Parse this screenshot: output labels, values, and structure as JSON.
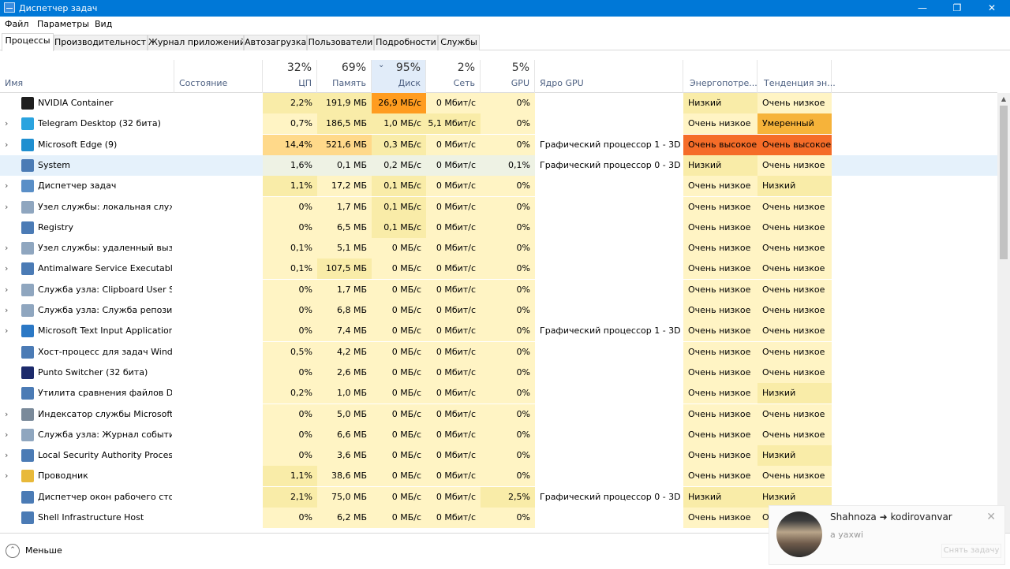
{
  "window": {
    "title": "Диспетчер задач",
    "minimize": "—",
    "maximize": "❐",
    "close": "✕"
  },
  "menu": [
    "Файл",
    "Параметры",
    "Вид"
  ],
  "tabs": [
    "Процессы",
    "Производительность",
    "Журнал приложений",
    "Автозагрузка",
    "Пользователи",
    "Подробности",
    "Службы"
  ],
  "columns": {
    "name": "Имя",
    "status": "Состояние",
    "cpu": {
      "pct": "32%",
      "label": "ЦП"
    },
    "mem": {
      "pct": "69%",
      "label": "Память"
    },
    "disk": {
      "pct": "95%",
      "label": "Диск",
      "sort": "⌄"
    },
    "net": {
      "pct": "2%",
      "label": "Сеть"
    },
    "gpu": {
      "pct": "5%",
      "label": "GPU"
    },
    "gpu_engine": "Ядро GPU",
    "power": "Энергопотре...",
    "power_trend": "Тенденция эн..."
  },
  "colors": {
    "heat_light": "#fff4c4",
    "heat_low": "#f9eca8",
    "heat_mid": "#ffd98a",
    "heat_high": "#f6b33a",
    "heat_orange": "#ff9c1f",
    "heat_red": "#f56c28"
  },
  "processes": [
    {
      "expand": "",
      "icon": "nvidia-icon",
      "icon_color": "#1e1e1e",
      "name": "NVIDIA Container",
      "status": "",
      "cpu": "2,2%",
      "mem": "191,9 МБ",
      "disk": "26,9 МБ/с",
      "net": "0 Мбит/с",
      "gpu": "0%",
      "engine": "",
      "power": "Низкий",
      "trend": "Очень низкое"
    },
    {
      "expand": "›",
      "icon": "telegram-icon",
      "icon_color": "#2aa3df",
      "name": "Telegram Desktop (32 бита)",
      "status": "",
      "cpu": "0,7%",
      "mem": "186,5 МБ",
      "disk": "1,0 МБ/с",
      "net": "5,1 Мбит/с",
      "gpu": "0%",
      "engine": "",
      "power": "Очень низкое",
      "trend": "Умеренный"
    },
    {
      "expand": "›",
      "icon": "edge-icon",
      "icon_color": "#1f8fd0",
      "name": "Microsoft Edge (9)",
      "status": "",
      "cpu": "14,4%",
      "mem": "521,6 МБ",
      "disk": "0,3 МБ/с",
      "net": "0 Мбит/с",
      "gpu": "0%",
      "engine": "Графический процессор 1 - 3D",
      "power": "Очень высокое",
      "trend": "Очень высокое"
    },
    {
      "expand": "",
      "icon": "system-icon",
      "icon_color": "#4b7bb5",
      "name": "System",
      "status": "",
      "cpu": "1,6%",
      "mem": "0,1 МБ",
      "disk": "0,2 МБ/с",
      "net": "0 Мбит/с",
      "gpu": "0,1%",
      "engine": "Графический процессор 0 - 3D",
      "power": "Низкий",
      "trend": "Очень низкое"
    },
    {
      "expand": "›",
      "icon": "task-manager-icon",
      "icon_color": "#5a8fc7",
      "name": "Диспетчер задач",
      "status": "",
      "cpu": "1,1%",
      "mem": "17,2 МБ",
      "disk": "0,1 МБ/с",
      "net": "0 Мбит/с",
      "gpu": "0%",
      "engine": "",
      "power": "Очень низкое",
      "trend": "Низкий"
    },
    {
      "expand": "›",
      "icon": "gear-icon",
      "icon_color": "#8fa6bf",
      "name": "Узел службы: локальная служ...",
      "status": "",
      "cpu": "0%",
      "mem": "1,7 МБ",
      "disk": "0,1 МБ/с",
      "net": "0 Мбит/с",
      "gpu": "0%",
      "engine": "",
      "power": "Очень низкое",
      "trend": "Очень низкое"
    },
    {
      "expand": "",
      "icon": "window-icon",
      "icon_color": "#4b7bb5",
      "name": "Registry",
      "status": "",
      "cpu": "0%",
      "mem": "6,5 МБ",
      "disk": "0,1 МБ/с",
      "net": "0 Мбит/с",
      "gpu": "0%",
      "engine": "",
      "power": "Очень низкое",
      "trend": "Очень низкое"
    },
    {
      "expand": "›",
      "icon": "gear-icon",
      "icon_color": "#8fa6bf",
      "name": "Узел службы: удаленный вызо...",
      "status": "",
      "cpu": "0,1%",
      "mem": "5,1 МБ",
      "disk": "0 МБ/с",
      "net": "0 Мбит/с",
      "gpu": "0%",
      "engine": "",
      "power": "Очень низкое",
      "trend": "Очень низкое"
    },
    {
      "expand": "›",
      "icon": "window-icon",
      "icon_color": "#4b7bb5",
      "name": "Antimalware Service Executable",
      "status": "",
      "cpu": "0,1%",
      "mem": "107,5 МБ",
      "disk": "0 МБ/с",
      "net": "0 Мбит/с",
      "gpu": "0%",
      "engine": "",
      "power": "Очень низкое",
      "trend": "Очень низкое"
    },
    {
      "expand": "›",
      "icon": "gear-icon",
      "icon_color": "#8fa6bf",
      "name": "Служба узла: Clipboard User Se...",
      "status": "",
      "cpu": "0%",
      "mem": "1,7 МБ",
      "disk": "0 МБ/с",
      "net": "0 Мбит/с",
      "gpu": "0%",
      "engine": "",
      "power": "Очень низкое",
      "trend": "Очень низкое"
    },
    {
      "expand": "›",
      "icon": "gear-icon",
      "icon_color": "#8fa6bf",
      "name": "Служба узла: Служба репозит...",
      "status": "",
      "cpu": "0%",
      "mem": "6,8 МБ",
      "disk": "0 МБ/с",
      "net": "0 Мбит/с",
      "gpu": "0%",
      "engine": "",
      "power": "Очень низкое",
      "trend": "Очень низкое"
    },
    {
      "expand": "›",
      "icon": "text-input-icon",
      "icon_color": "#2b78c5",
      "name": "Microsoft Text Input Application",
      "status": "",
      "cpu": "0%",
      "mem": "7,4 МБ",
      "disk": "0 МБ/с",
      "net": "0 Мбит/с",
      "gpu": "0%",
      "engine": "Графический процессор 1 - 3D",
      "power": "Очень низкое",
      "trend": "Очень низкое"
    },
    {
      "expand": "",
      "icon": "window-icon",
      "icon_color": "#4b7bb5",
      "name": "Хост-процесс для задач Windo...",
      "status": "",
      "cpu": "0,5%",
      "mem": "4,2 МБ",
      "disk": "0 МБ/с",
      "net": "0 Мбит/с",
      "gpu": "0%",
      "engine": "",
      "power": "Очень низкое",
      "trend": "Очень низкое"
    },
    {
      "expand": "",
      "icon": "punto-icon",
      "icon_color": "#1c2a6b",
      "name": "Punto Switcher (32 бита)",
      "status": "",
      "cpu": "0%",
      "mem": "2,6 МБ",
      "disk": "0 МБ/с",
      "net": "0 Мбит/с",
      "gpu": "0%",
      "engine": "",
      "power": "Очень низкое",
      "trend": "Очень низкое"
    },
    {
      "expand": "",
      "icon": "window-icon",
      "icon_color": "#4b7bb5",
      "name": "Утилита сравнения файлов D...",
      "status": "",
      "cpu": "0,2%",
      "mem": "1,0 МБ",
      "disk": "0 МБ/с",
      "net": "0 Мбит/с",
      "gpu": "0%",
      "engine": "",
      "power": "Очень низкое",
      "trend": "Низкий"
    },
    {
      "expand": "›",
      "icon": "user-icon",
      "icon_color": "#7a8a9a",
      "name": "Индексатор службы Microsoft ...",
      "status": "",
      "cpu": "0%",
      "mem": "5,0 МБ",
      "disk": "0 МБ/с",
      "net": "0 Мбит/с",
      "gpu": "0%",
      "engine": "",
      "power": "Очень низкое",
      "trend": "Очень низкое"
    },
    {
      "expand": "›",
      "icon": "gear-icon",
      "icon_color": "#8fa6bf",
      "name": "Служба узла: Журнал событи...",
      "status": "",
      "cpu": "0%",
      "mem": "6,6 МБ",
      "disk": "0 МБ/с",
      "net": "0 Мбит/с",
      "gpu": "0%",
      "engine": "",
      "power": "Очень низкое",
      "trend": "Очень низкое"
    },
    {
      "expand": "›",
      "icon": "window-icon",
      "icon_color": "#4b7bb5",
      "name": "Local Security Authority Process...",
      "status": "",
      "cpu": "0%",
      "mem": "3,6 МБ",
      "disk": "0 МБ/с",
      "net": "0 Мбит/с",
      "gpu": "0%",
      "engine": "",
      "power": "Очень низкое",
      "trend": "Низкий"
    },
    {
      "expand": "›",
      "icon": "folder-icon",
      "icon_color": "#e8b93a",
      "name": "Проводник",
      "status": "",
      "cpu": "1,1%",
      "mem": "38,6 МБ",
      "disk": "0 МБ/с",
      "net": "0 Мбит/с",
      "gpu": "0%",
      "engine": "",
      "power": "Очень низкое",
      "trend": "Очень низкое"
    },
    {
      "expand": "",
      "icon": "window-icon",
      "icon_color": "#4b7bb5",
      "name": "Диспетчер окон рабочего стола",
      "status": "",
      "cpu": "2,1%",
      "mem": "75,0 МБ",
      "disk": "0 МБ/с",
      "net": "0 Мбит/с",
      "gpu": "2,5%",
      "engine": "Графический процессор 0 - 3D",
      "power": "Низкий",
      "trend": "Низкий"
    },
    {
      "expand": "",
      "icon": "window-icon",
      "icon_color": "#4b7bb5",
      "name": "Shell Infrastructure Host",
      "status": "",
      "cpu": "0%",
      "mem": "6,2 МБ",
      "disk": "0 МБ/с",
      "net": "0 Мбит/с",
      "gpu": "0%",
      "engine": "",
      "power": "Очень низкое",
      "trend": "О"
    }
  ],
  "footer": {
    "less_label": "Меньше",
    "less_icon": "⌃"
  },
  "toast": {
    "name": "Shahnoza ➜ kodirovanvar",
    "message": "a yaxwi",
    "close": "✕",
    "button": "Снять задачу"
  }
}
